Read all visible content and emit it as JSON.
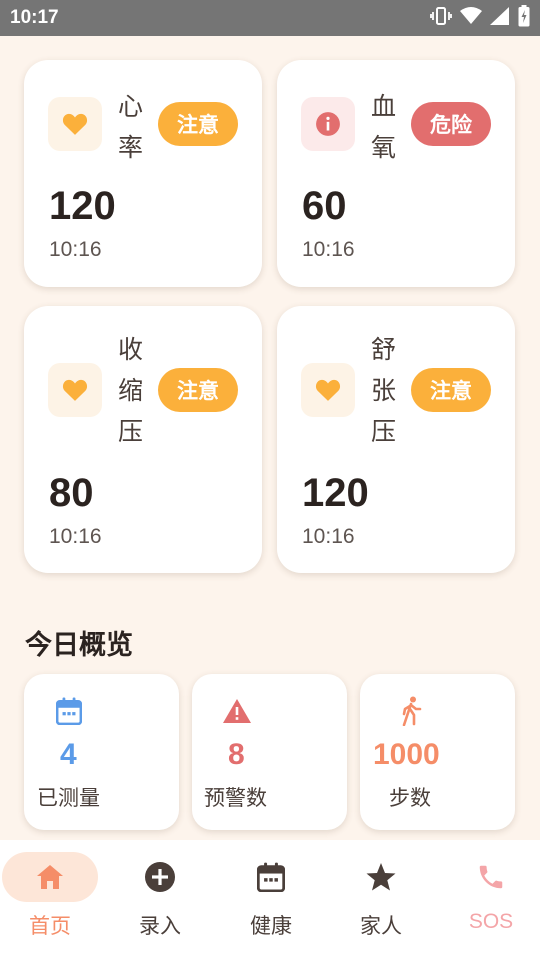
{
  "status_bar": {
    "time": "10:17",
    "icons": [
      "vibrate-icon",
      "wifi-icon",
      "signal-icon",
      "battery-icon"
    ]
  },
  "vitals": [
    {
      "name": "心率",
      "value": "120",
      "time": "10:16",
      "status": "注意",
      "icon": "heart-icon"
    },
    {
      "name": "血氧",
      "value": "60",
      "time": "10:16",
      "status": "危险",
      "icon": "info-icon"
    },
    {
      "name": "收缩压",
      "value": "80",
      "time": "10:16",
      "status": "注意",
      "icon": "heart-icon"
    },
    {
      "name": "舒张压",
      "value": "120",
      "time": "10:16",
      "status": "注意",
      "icon": "heart-icon"
    }
  ],
  "overview": {
    "title": "今日概览",
    "items": [
      {
        "value": "4",
        "label": "已测量",
        "icon": "calendar-icon",
        "color": "#5B9BE8"
      },
      {
        "value": "8",
        "label": "预警数",
        "icon": "warning-icon",
        "color": "#E26E6E"
      },
      {
        "value": "1000",
        "label": "步数",
        "icon": "walk-icon",
        "color": "#F58D68"
      }
    ]
  },
  "nav": {
    "items": [
      {
        "label": "首页",
        "icon": "home-icon",
        "active": true
      },
      {
        "label": "录入",
        "icon": "add-circle-icon"
      },
      {
        "label": "健康",
        "icon": "calendar-icon"
      },
      {
        "label": "家人",
        "icon": "star-icon"
      },
      {
        "label": "SOS",
        "icon": "phone-icon"
      }
    ]
  },
  "colors": {
    "background": "#FDF4EC",
    "warning_badge": "#FBB03B",
    "danger_badge": "#E26E6E",
    "nav_active": "#F58D68",
    "sos": "#F4A5A8"
  }
}
